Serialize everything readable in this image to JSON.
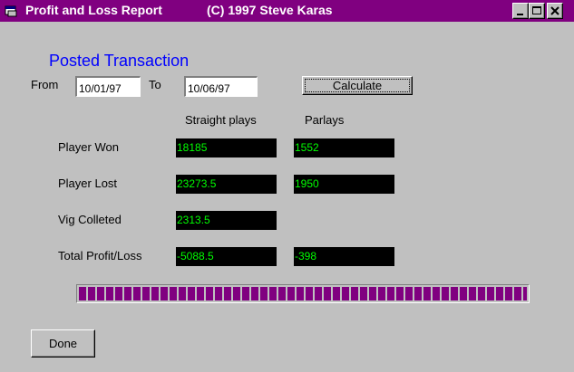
{
  "window": {
    "title": "Profit and Loss Report",
    "credit": "(C) 1997 Steve Karas"
  },
  "colors": {
    "titlebar": "#800080",
    "heading": "#0000ff",
    "value_text": "#00ff00",
    "value_bg": "#000000"
  },
  "icons": {
    "app": "app-icon",
    "minimize": "minimize-icon",
    "maximize": "maximize-icon",
    "close": "close-icon"
  },
  "heading": "Posted Transaction",
  "date_range": {
    "from_label": "From",
    "from_value": "10/01/97",
    "to_label": "To",
    "to_value": "10/06/97",
    "calculate_label": "Calculate"
  },
  "columns": {
    "straight": "Straight plays",
    "parlays": "Parlays"
  },
  "rows": [
    {
      "label": "Player Won",
      "straight": "18185",
      "parlays": "1552"
    },
    {
      "label": "Player Lost",
      "straight": "23273.5",
      "parlays": "1950"
    },
    {
      "label": "Vig Colleted",
      "straight": "2313.5"
    },
    {
      "label": "Total Profit/Loss",
      "straight": "-5088.5",
      "parlays": "-398"
    }
  ],
  "progress": {
    "percent": 100
  },
  "done_label": "Done"
}
